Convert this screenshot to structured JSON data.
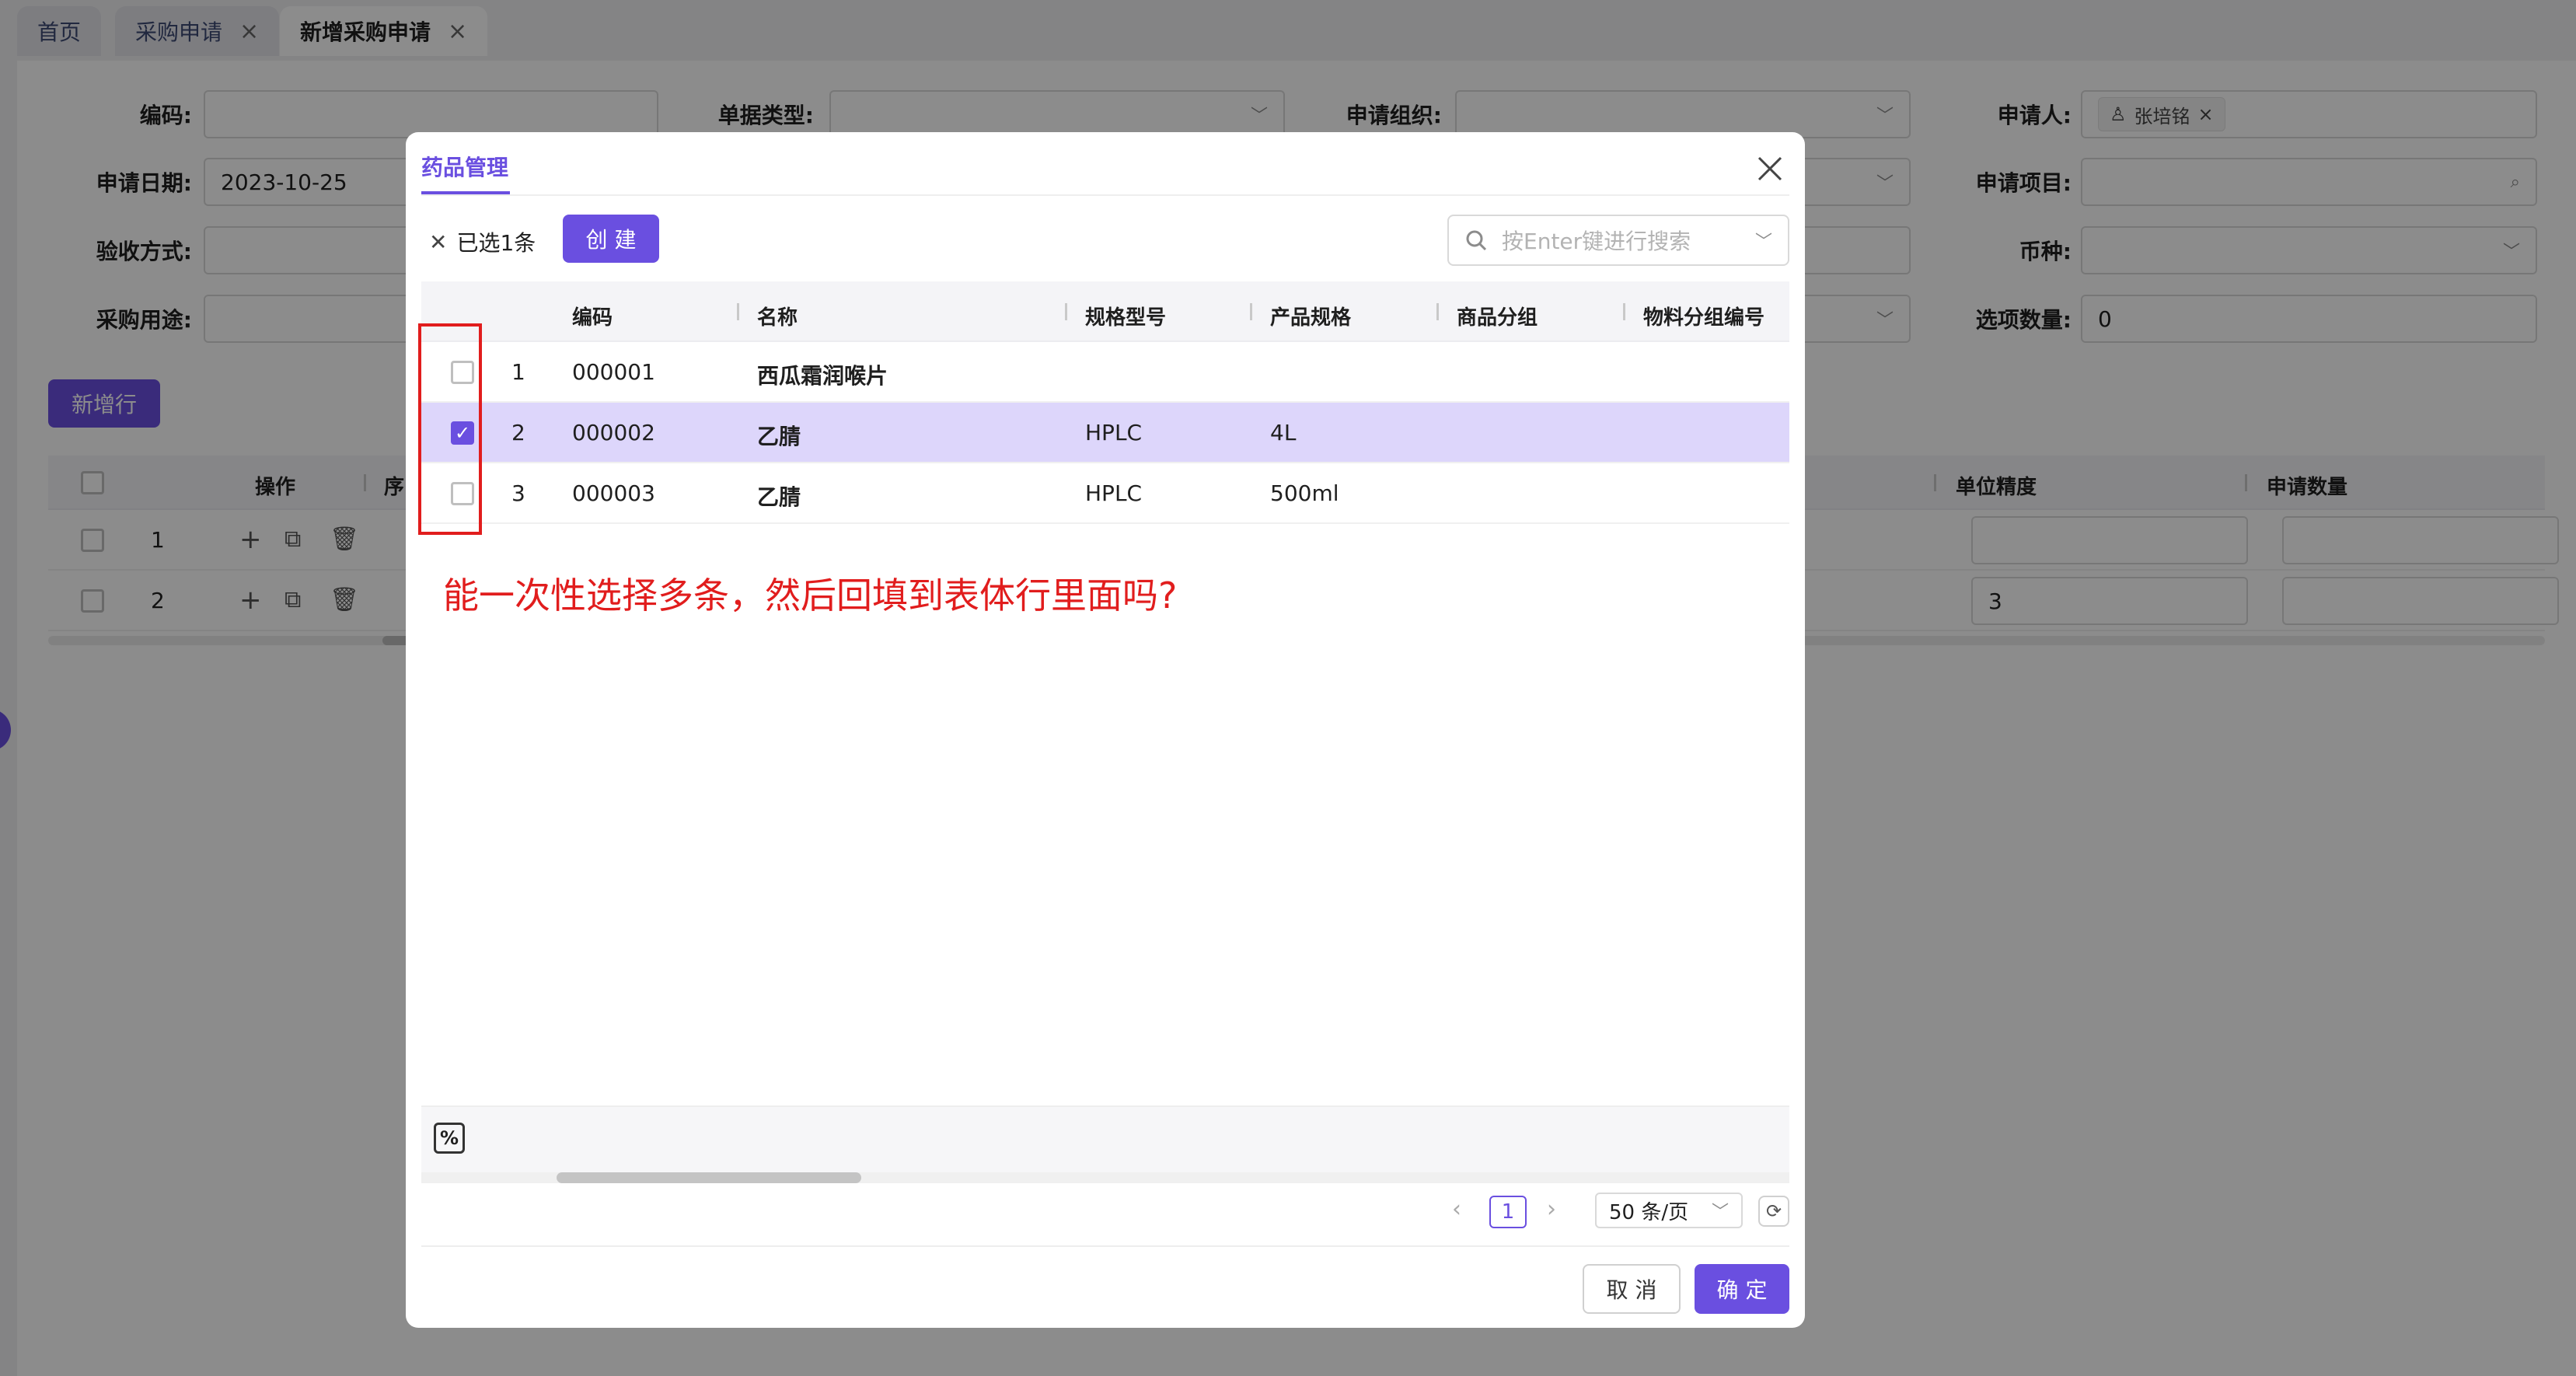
{
  "tabs": [
    {
      "label": "首页",
      "closable": false
    },
    {
      "label": "采购申请",
      "closable": true
    },
    {
      "label": "新增采购申请",
      "closable": true,
      "active": true
    }
  ],
  "form": {
    "code_label": "编码:",
    "doc_type_label": "单据类型:",
    "org_label": "申请组织:",
    "applicant_label": "申请人:",
    "applicant_value": "张培铭",
    "date_label": "申请日期:",
    "date_value": "2023-10-25",
    "project_label": "申请项目:",
    "accept_label": "验收方式:",
    "currency_label": "币种:",
    "purpose_label": "采购用途:",
    "option_count_label": "选项数量:",
    "option_count_value": "0"
  },
  "detail": {
    "add_row_button": "新增行",
    "col_ops": "操作",
    "col_seq": "序",
    "col_unit_precision": "单位精度",
    "col_apply_qty": "申请数量",
    "rows": [
      {
        "index": "1",
        "unit_precision": ""
      },
      {
        "index": "2",
        "unit_precision": "3"
      }
    ]
  },
  "modal": {
    "title": "药品管理",
    "selected_text": "已选1条",
    "create_button": "创 建",
    "search_placeholder": "按Enter键进行搜索",
    "columns": [
      "编码",
      "名称",
      "规格型号",
      "产品规格",
      "商品分组",
      "物料分组编号"
    ],
    "rows": [
      {
        "seq": "1",
        "code": "000001",
        "name": "西瓜霜润喉片",
        "model": "",
        "spec": "",
        "checked": false
      },
      {
        "seq": "2",
        "code": "000002",
        "name": "乙腈",
        "model": "HPLC",
        "spec": "4L",
        "checked": true
      },
      {
        "seq": "3",
        "code": "000003",
        "name": "乙腈",
        "model": "HPLC",
        "spec": "500ml",
        "checked": false
      }
    ],
    "annotation": "能一次性选择多条，然后回填到表体行里面吗?",
    "pagination": {
      "current_page": "1",
      "page_size": "50 条/页"
    },
    "cancel_button": "取 消",
    "ok_button": "确 定"
  },
  "colors": {
    "primary": "#6a4fe0",
    "selected_row": "#ddd6fb",
    "annotation": "#e11d1d"
  }
}
